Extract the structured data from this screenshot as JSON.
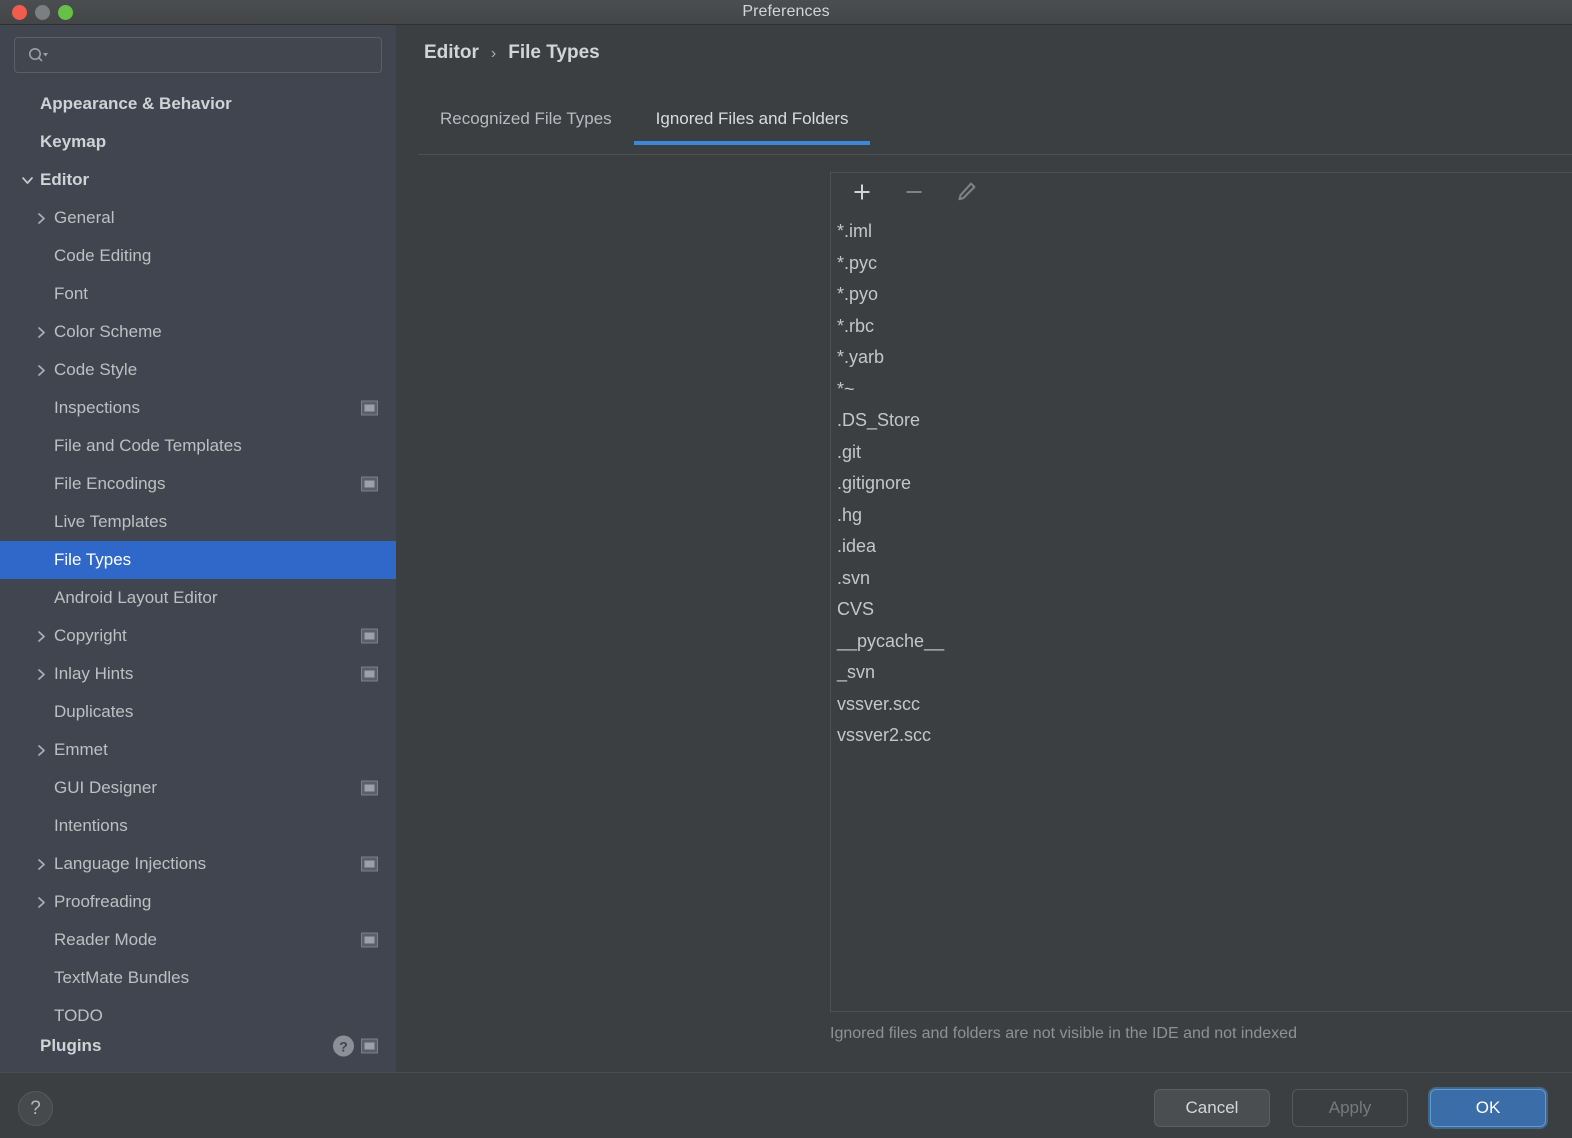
{
  "window": {
    "title": "Preferences",
    "traffic_lights": [
      "close",
      "minimize",
      "zoom"
    ]
  },
  "search": {
    "value": "",
    "placeholder": "",
    "icon": "search-icon"
  },
  "sidebar": {
    "items": [
      {
        "label": "Appearance & Behavior",
        "level": 1,
        "bold": true,
        "chevron": "none",
        "badge": false,
        "selected": false
      },
      {
        "label": "Keymap",
        "level": 1,
        "bold": true,
        "chevron": "none",
        "badge": false,
        "selected": false
      },
      {
        "label": "Editor",
        "level": 1,
        "bold": true,
        "chevron": "expanded",
        "badge": false,
        "selected": false
      },
      {
        "label": "General",
        "level": 2,
        "bold": false,
        "chevron": "collapsed",
        "badge": false,
        "selected": false
      },
      {
        "label": "Code Editing",
        "level": 2,
        "bold": false,
        "chevron": "none",
        "badge": false,
        "selected": false
      },
      {
        "label": "Font",
        "level": 2,
        "bold": false,
        "chevron": "none",
        "badge": false,
        "selected": false
      },
      {
        "label": "Color Scheme",
        "level": 2,
        "bold": false,
        "chevron": "collapsed",
        "badge": false,
        "selected": false
      },
      {
        "label": "Code Style",
        "level": 2,
        "bold": false,
        "chevron": "collapsed",
        "badge": false,
        "selected": false
      },
      {
        "label": "Inspections",
        "level": 2,
        "bold": false,
        "chevron": "none",
        "badge": true,
        "selected": false
      },
      {
        "label": "File and Code Templates",
        "level": 2,
        "bold": false,
        "chevron": "none",
        "badge": false,
        "selected": false
      },
      {
        "label": "File Encodings",
        "level": 2,
        "bold": false,
        "chevron": "none",
        "badge": true,
        "selected": false
      },
      {
        "label": "Live Templates",
        "level": 2,
        "bold": false,
        "chevron": "none",
        "badge": false,
        "selected": false
      },
      {
        "label": "File Types",
        "level": 2,
        "bold": false,
        "chevron": "none",
        "badge": false,
        "selected": true
      },
      {
        "label": "Android Layout Editor",
        "level": 2,
        "bold": false,
        "chevron": "none",
        "badge": false,
        "selected": false
      },
      {
        "label": "Copyright",
        "level": 2,
        "bold": false,
        "chevron": "collapsed",
        "badge": true,
        "selected": false
      },
      {
        "label": "Inlay Hints",
        "level": 2,
        "bold": false,
        "chevron": "collapsed",
        "badge": true,
        "selected": false
      },
      {
        "label": "Duplicates",
        "level": 2,
        "bold": false,
        "chevron": "none",
        "badge": false,
        "selected": false
      },
      {
        "label": "Emmet",
        "level": 2,
        "bold": false,
        "chevron": "collapsed",
        "badge": false,
        "selected": false
      },
      {
        "label": "GUI Designer",
        "level": 2,
        "bold": false,
        "chevron": "none",
        "badge": true,
        "selected": false
      },
      {
        "label": "Intentions",
        "level": 2,
        "bold": false,
        "chevron": "none",
        "badge": false,
        "selected": false
      },
      {
        "label": "Language Injections",
        "level": 2,
        "bold": false,
        "chevron": "collapsed",
        "badge": true,
        "selected": false
      },
      {
        "label": "Proofreading",
        "level": 2,
        "bold": false,
        "chevron": "collapsed",
        "badge": false,
        "selected": false
      },
      {
        "label": "Reader Mode",
        "level": 2,
        "bold": false,
        "chevron": "none",
        "badge": true,
        "selected": false
      },
      {
        "label": "TextMate Bundles",
        "level": 2,
        "bold": false,
        "chevron": "none",
        "badge": false,
        "selected": false
      },
      {
        "label": "TODO",
        "level": 2,
        "bold": false,
        "chevron": "none",
        "badge": false,
        "selected": false
      },
      {
        "label": "Plugins",
        "level": 1,
        "bold": true,
        "chevron": "none",
        "badge": true,
        "badge_circle": "?",
        "selected": false,
        "clipped": true
      }
    ]
  },
  "breadcrumb": {
    "root": "Editor",
    "separator": "›",
    "current": "File Types"
  },
  "tabs": [
    {
      "label": "Recognized File Types",
      "active": false
    },
    {
      "label": "Ignored Files and Folders",
      "active": true
    }
  ],
  "toolbar": {
    "add_label": "+",
    "remove_label": "−",
    "edit_label": "edit",
    "add_enabled": true,
    "remove_enabled": false,
    "edit_enabled": false
  },
  "ignored_list": [
    "*.iml",
    "*.pyc",
    "*.pyo",
    "*.rbc",
    "*.yarb",
    "*~",
    ".DS_Store",
    ".git",
    ".gitignore",
    ".hg",
    ".idea",
    ".svn",
    "CVS",
    "__pycache__",
    "_svn",
    "vssver.scc",
    "vssver2.scc"
  ],
  "hint": "Ignored files and folders are not visible in the IDE and not indexed",
  "footer": {
    "help_label": "?",
    "cancel_label": "Cancel",
    "apply_label": "Apply",
    "ok_label": "OK",
    "apply_enabled": false
  },
  "colors": {
    "window_bg": "#3c3f41",
    "sidebar_bg": "#41454f",
    "selection_blue": "#3068c9",
    "tab_underline_blue": "#3d87d8",
    "primary_button_blue": "#3b6ea8",
    "text": "#c3c7ca",
    "muted_text": "#8e9295"
  }
}
